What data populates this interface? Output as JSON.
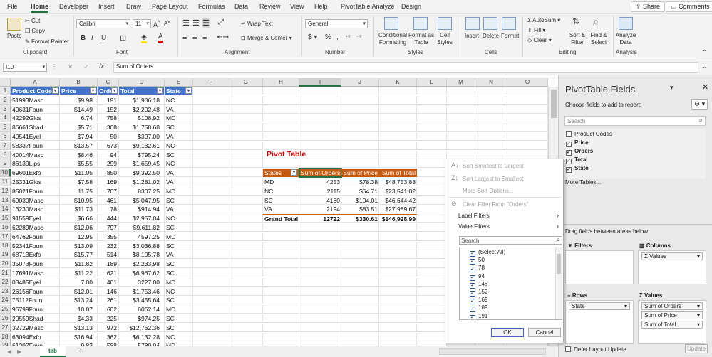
{
  "menu": {
    "tabs": [
      "File",
      "Home",
      "Developer",
      "Insert",
      "Draw",
      "Page Layout",
      "Formulas",
      "Data",
      "Review",
      "View",
      "Help",
      "PivotTable Analyze",
      "Design"
    ],
    "share": "Share",
    "comments": "Comments"
  },
  "ribbon": {
    "clipboard": {
      "paste": "Paste",
      "cut": "Cut",
      "copy": "Copy",
      "format_painter": "Format Painter",
      "label": "Clipboard"
    },
    "font": {
      "name": "Calibri",
      "size": "11",
      "label": "Font"
    },
    "alignment": {
      "wrap": "Wrap Text",
      "merge": "Merge & Center",
      "label": "Alignment"
    },
    "number": {
      "format": "General",
      "label": "Number"
    },
    "styles": {
      "conditional": "Conditional Formatting",
      "format_table": "Format as Table",
      "cell_styles": "Cell Styles",
      "label": "Styles"
    },
    "cells": {
      "insert": "Insert",
      "delete": "Delete",
      "format": "Format",
      "label": "Cells"
    },
    "editing": {
      "autosum": "AutoSum",
      "fill": "Fill",
      "clear": "Clear",
      "sort": "Sort & Filter",
      "find": "Find & Select",
      "label": "Editing"
    },
    "analysis": {
      "analyze": "Analyze Data",
      "label": "Analysis"
    }
  },
  "formula_bar": {
    "name_box": "I10",
    "fx": "fx",
    "content": "Sum of Orders"
  },
  "grid": {
    "columns": [
      "A",
      "B",
      "C",
      "D",
      "E",
      "F",
      "G",
      "H",
      "I",
      "J",
      "K",
      "L",
      "M",
      "N",
      "O"
    ],
    "table_headers": [
      "Product Codes",
      "Price",
      "Orders",
      "Total",
      "State"
    ],
    "rows": [
      [
        "51993Masc",
        "$9.98",
        "191",
        "$1,906.18",
        "NC"
      ],
      [
        "49631Foun",
        "$14.49",
        "152",
        "$2,202.48",
        "VA"
      ],
      [
        "42292Glos",
        "6.74",
        "758",
        "5108.92",
        "MD"
      ],
      [
        "86661Shad",
        "$5.71",
        "308",
        "$1,758.68",
        "SC"
      ],
      [
        "49541Eyel",
        "$7.94",
        "50",
        "$397.00",
        "VA"
      ],
      [
        "58337Foun",
        "$13.57",
        "673",
        "$9,132.61",
        "NC"
      ],
      [
        "40014Masc",
        "$8.46",
        "94",
        "$795.24",
        "SC"
      ],
      [
        "86139Lips",
        "$5.55",
        "299",
        "$1,659.45",
        "NC"
      ],
      [
        "69601Exfo",
        "$11.05",
        "850",
        "$9,392.50",
        "VA"
      ],
      [
        "25331Glos",
        "$7.58",
        "169",
        "$1,281.02",
        "VA"
      ],
      [
        "85021Foun",
        "11.75",
        "707",
        "8307.25",
        "MD"
      ],
      [
        "69030Masc",
        "$10.95",
        "461",
        "$5,047.95",
        "SC"
      ],
      [
        "13230Masc",
        "$11.73",
        "78",
        "$914.94",
        "VA"
      ],
      [
        "91559Eyel",
        "$6.66",
        "444",
        "$2,957.04",
        "NC"
      ],
      [
        "62289Masc",
        "$12.06",
        "797",
        "$9,611.82",
        "SC"
      ],
      [
        "64762Foun",
        "12.95",
        "355",
        "4597.25",
        "MD"
      ],
      [
        "52341Foun",
        "$13.09",
        "232",
        "$3,036.88",
        "SC"
      ],
      [
        "68713Exfo",
        "$15.77",
        "514",
        "$8,105.78",
        "VA"
      ],
      [
        "35073Foun",
        "$11.82",
        "189",
        "$2,233.98",
        "SC"
      ],
      [
        "17691Masc",
        "$11.22",
        "621",
        "$6,967.62",
        "SC"
      ],
      [
        "03485Eyel",
        "7.00",
        "461",
        "3227.00",
        "MD"
      ],
      [
        "26156Foun",
        "$12.01",
        "146",
        "$1,753.46",
        "NC"
      ],
      [
        "75112Foun",
        "$13.24",
        "261",
        "$3,455.64",
        "SC"
      ],
      [
        "96799Foun",
        "10.07",
        "602",
        "6062.14",
        "MD"
      ],
      [
        "20559Shad",
        "$4.33",
        "225",
        "$974.25",
        "SC"
      ],
      [
        "32729Masc",
        "$13.13",
        "972",
        "$12,762.36",
        "SC"
      ],
      [
        "63094Exfo",
        "$16.94",
        "362",
        "$6,132.28",
        "NC"
      ],
      [
        "61207Foun",
        "9.83",
        "588",
        "5780.04",
        "MD"
      ]
    ]
  },
  "pivot": {
    "title": "Pivot Table",
    "headers": [
      "States",
      "Sum of Orders",
      "Sum of Price",
      "Sum of Total"
    ],
    "rows": [
      [
        "MD",
        "4253",
        "$78.38",
        "$48,753.88"
      ],
      [
        "NC",
        "2115",
        "$64.71",
        "$23,541.02"
      ],
      [
        "SC",
        "4160",
        "$104.01",
        "$46,644.42"
      ],
      [
        "VA",
        "2194",
        "$83.51",
        "$27,989.67"
      ]
    ],
    "total": [
      "Grand Total",
      "12722",
      "$330.61",
      "$146,928.99"
    ]
  },
  "dropdown": {
    "sort_asc": "Sort Smallest to Largest",
    "sort_desc": "Sort Largest to Smallest",
    "more_sort": "More Sort Options...",
    "clear_filter": "Clear Filter From \"Orders\"",
    "label_filters": "Label Filters",
    "value_filters": "Value Filters",
    "search_placeholder": "Search",
    "items": [
      "(Select All)",
      "50",
      "78",
      "94",
      "146",
      "152",
      "169",
      "189",
      "191"
    ],
    "ok": "OK",
    "cancel": "Cancel"
  },
  "panel": {
    "title": "PivotTable Fields",
    "subtitle": "Choose fields to add to report:",
    "search_placeholder": "Search",
    "fields": [
      {
        "name": "Product Codes",
        "checked": false
      },
      {
        "name": "Price",
        "checked": true
      },
      {
        "name": "Orders",
        "checked": true
      },
      {
        "name": "Total",
        "checked": true
      },
      {
        "name": "State",
        "checked": true
      }
    ],
    "more_tables": "More Tables...",
    "drag_label": "Drag fields between areas below:",
    "filters": "Filters",
    "columns": "Columns",
    "columns_chip": "Values",
    "rows": "Rows",
    "rows_chip": "State",
    "values": "Values",
    "values_chips": [
      "Sum of Orders",
      "Sum of Price",
      "Sum of Total"
    ],
    "defer": "Defer Layout Update",
    "update": "Update"
  },
  "sheet": {
    "tab": "tab",
    "add": "+"
  }
}
